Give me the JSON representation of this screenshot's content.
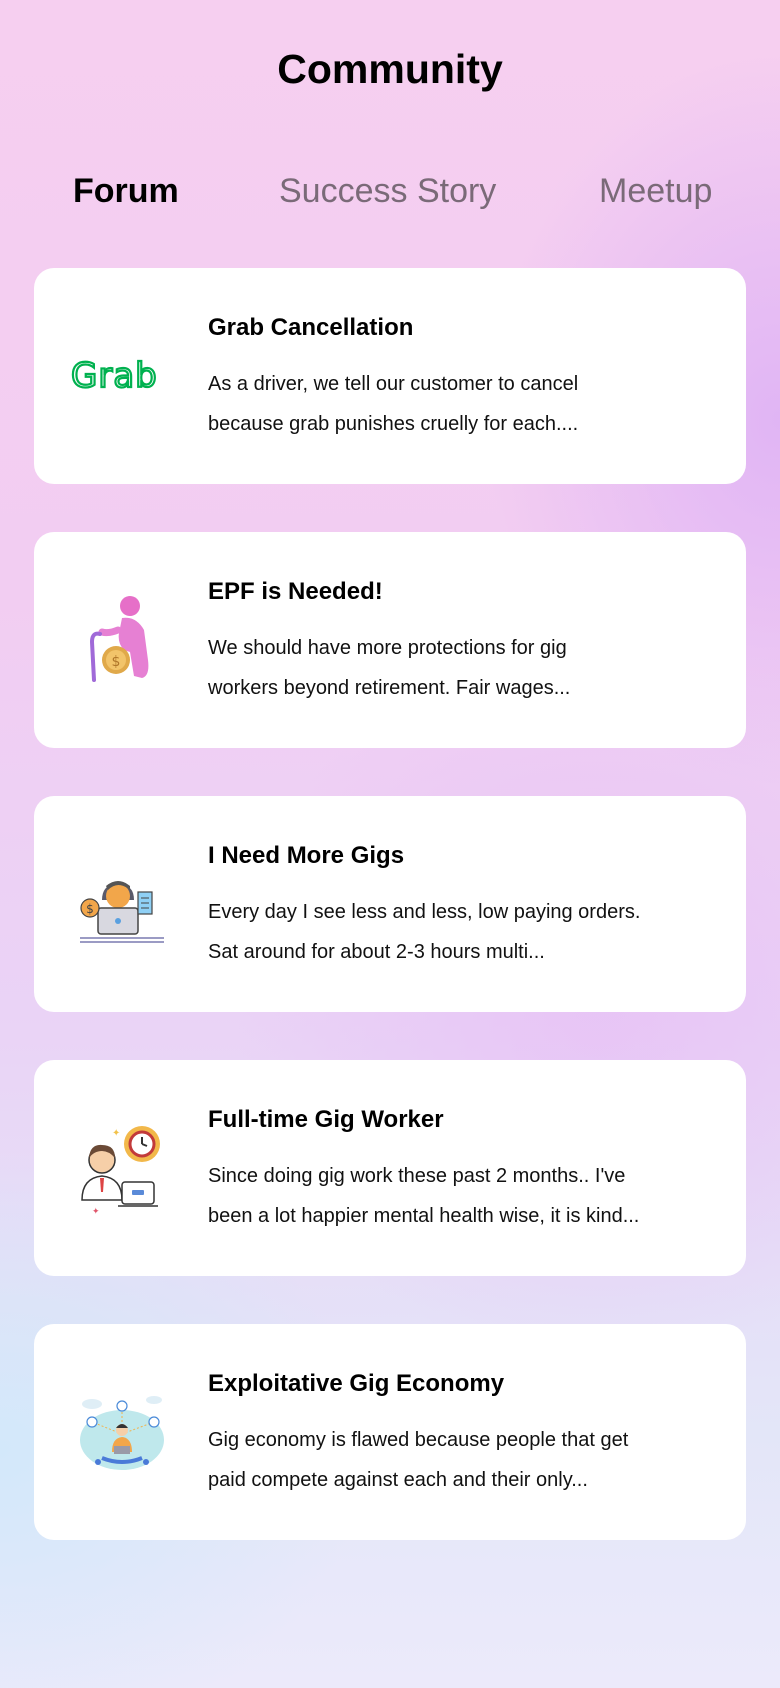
{
  "header": {
    "title": "Community"
  },
  "tabs": [
    {
      "label": "Forum",
      "active": true
    },
    {
      "label": "Success Story",
      "active": false
    },
    {
      "label": "Meetup",
      "active": false
    }
  ],
  "posts": [
    {
      "icon": "grab-logo-icon",
      "logo_text": "Grab",
      "title": "Grab Cancellation",
      "excerpt_line1": "As a driver, we tell our customer to cancel",
      "excerpt_line2": "because grab punishes cruelly for each...."
    },
    {
      "icon": "elderly-person-coin-icon",
      "title": "EPF is Needed!",
      "excerpt_line1": "We should have more protections for gig",
      "excerpt_line2": "workers beyond retirement. Fair wages..."
    },
    {
      "icon": "worker-laptop-icon",
      "title": "I Need More Gigs",
      "excerpt_line1": "Every day I see less and less, low paying orders.",
      "excerpt_line2": "Sat around for about 2-3 hours multi..."
    },
    {
      "icon": "office-worker-clock-icon",
      "title": "Full-time Gig Worker",
      "excerpt_line1": "Since doing gig work these past 2 months.. I've",
      "excerpt_line2": "been a lot happier mental health wise, it is kind..."
    },
    {
      "icon": "gig-network-icon",
      "title": "Exploitative Gig Economy",
      "excerpt_line1": "Gig economy is flawed because people that get",
      "excerpt_line2": "paid compete against each and their only..."
    }
  ],
  "colors": {
    "grab_green": "#00b14f",
    "active_tab": "#000000",
    "inactive_tab": "#7a6a78"
  }
}
